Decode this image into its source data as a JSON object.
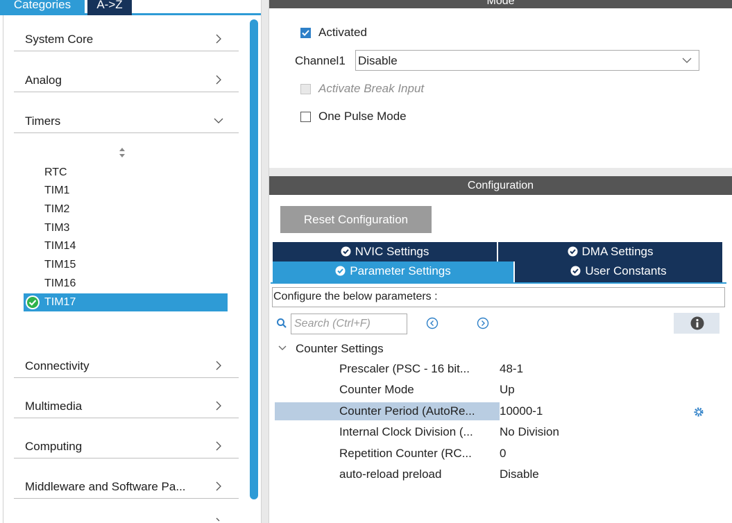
{
  "left": {
    "tabs": [
      "Categories",
      "A->Z"
    ],
    "categories": [
      {
        "label": "System Core"
      },
      {
        "label": "Analog"
      },
      {
        "label": "Timers"
      },
      {
        "label": "Connectivity"
      },
      {
        "label": "Multimedia"
      },
      {
        "label": "Computing"
      },
      {
        "label": "Middleware and Software Pa..."
      }
    ],
    "timers": [
      "RTC",
      "TIM1",
      "TIM2",
      "TIM3",
      "TIM14",
      "TIM15",
      "TIM16"
    ],
    "selected_timer": "TIM17"
  },
  "mode": {
    "title": "Mode",
    "activated_label": "Activated",
    "channel_label": "Channel1",
    "channel_value": "Disable",
    "break_label": "Activate Break Input",
    "one_pulse_label": "One Pulse Mode"
  },
  "config": {
    "title": "Configuration",
    "reset_label": "Reset Configuration",
    "tabs": {
      "nvic": "NVIC Settings",
      "dma": "DMA Settings",
      "param": "Parameter Settings",
      "user": "User Constants"
    },
    "configure_text": "Configure the below parameters :",
    "search_placeholder": "Search (Ctrl+F)",
    "group_label": "Counter Settings",
    "params": [
      {
        "key": "Prescaler (PSC - 16 bit...",
        "value": "48-1"
      },
      {
        "key": "Counter Mode",
        "value": "Up"
      },
      {
        "key": "Counter Period (AutoRe...",
        "value": "10000-1"
      },
      {
        "key": "Internal Clock Division (...",
        "value": "No Division"
      },
      {
        "key": "Repetition Counter (RC...",
        "value": "0"
      },
      {
        "key": "auto-reload preload",
        "value": "Disable"
      }
    ]
  },
  "colors": {
    "accent": "#2e9bd6",
    "dark_tab": "#16335a",
    "header": "#555555",
    "selected_row": "#b9cde2"
  }
}
